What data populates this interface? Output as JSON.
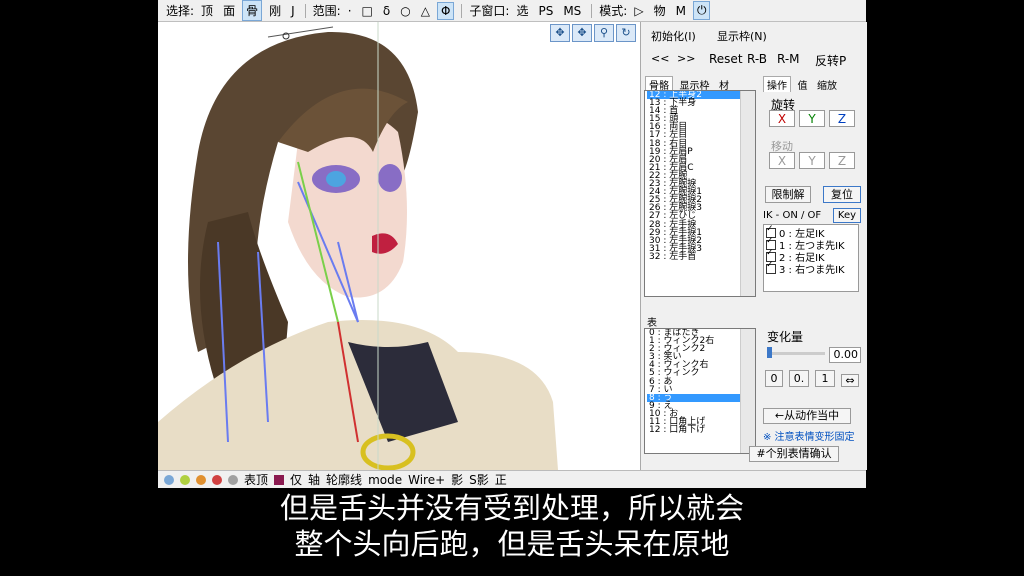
{
  "toolbar": {
    "select_label": "选择:",
    "modes": [
      "顶",
      "面",
      "骨",
      "刚",
      "J"
    ],
    "range_label": "范围:",
    "range_tools": [
      "·",
      "□",
      "δ",
      "○",
      "△",
      "Φ"
    ],
    "subwin_label": "子窗口:",
    "subwin_items": [
      "选",
      "PS",
      "MS"
    ],
    "mode_label": "模式:",
    "mode_items": [
      "▷",
      "物",
      "M"
    ]
  },
  "viewport": {
    "tools": [
      "✥",
      "✥",
      "⚲",
      "↻"
    ]
  },
  "bottombar": {
    "items": [
      "表顶",
      "仅",
      "轴",
      "轮廓线",
      "mode",
      "Wire+",
      "影",
      "S影",
      "正"
    ]
  },
  "panel": {
    "init_label": "初始化(I)",
    "display_frame_label": "显示枠(N)",
    "nav_prev": "<<",
    "nav_next": ">>",
    "reset": "Reset",
    "rb": "R-B",
    "rm": "R-M",
    "flip": "反转P",
    "bone_tabs": [
      "骨骼",
      "显示枠",
      "材"
    ],
    "op_tabs": [
      "操作",
      "值",
      "缩放"
    ],
    "bones": [
      "12 : 上半身2",
      "13 : 下半身",
      "14 : 首",
      "15 : 頭",
      "16 : 両目",
      "17 : 左目",
      "18 : 右目",
      "19 : 左肩P",
      "20 : 左肩",
      "21 : 左肩C",
      "22 : 左腕",
      "23 : 左腕捩",
      "24 : 左腕捩1",
      "25 : 左腕捩2",
      "26 : 左腕捩3",
      "27 : 左ひじ",
      "28 : 左手捩",
      "29 : 左手捩1",
      "30 : 左手捩2",
      "31 : 左手捩3",
      "32 : 左手首"
    ],
    "rotate_label": "旋转",
    "move_label": "移动",
    "axes": [
      "X",
      "Y",
      "Z"
    ],
    "limit_label": "限制解",
    "reset_pos_label": "复位",
    "ik_label": "IK - ON / OF",
    "key_label": "Key",
    "ik_items": [
      "0 : 左足IK",
      "1 : 左つま先IK",
      "2 : 右足IK",
      "3 : 右つま先IK"
    ],
    "morph_label": "表",
    "morphs": [
      "0 : まばたき",
      "1 : ウィンク2右",
      "2 : ウィンク2",
      "3 : 笑い",
      "4 : ウィンク右",
      "5 : ウィンク",
      "6 : あ",
      "7 : い",
      "8 : う",
      "9 : え",
      "10 : お",
      "11 : 口角上げ",
      "12 : 口角下げ"
    ],
    "change_label": "变化量",
    "change_value": "0.00",
    "val_buttons": [
      "0",
      "0.",
      "1"
    ],
    "from_motion": "←从动作当中",
    "note": "※ 注意表情变形固定",
    "confirm": "#个别表情确认"
  },
  "subtitle": {
    "line1": "但是舌头并没有受到处理，所以就会",
    "line2": "整个头向后跑，但是舌头呆在原地"
  }
}
